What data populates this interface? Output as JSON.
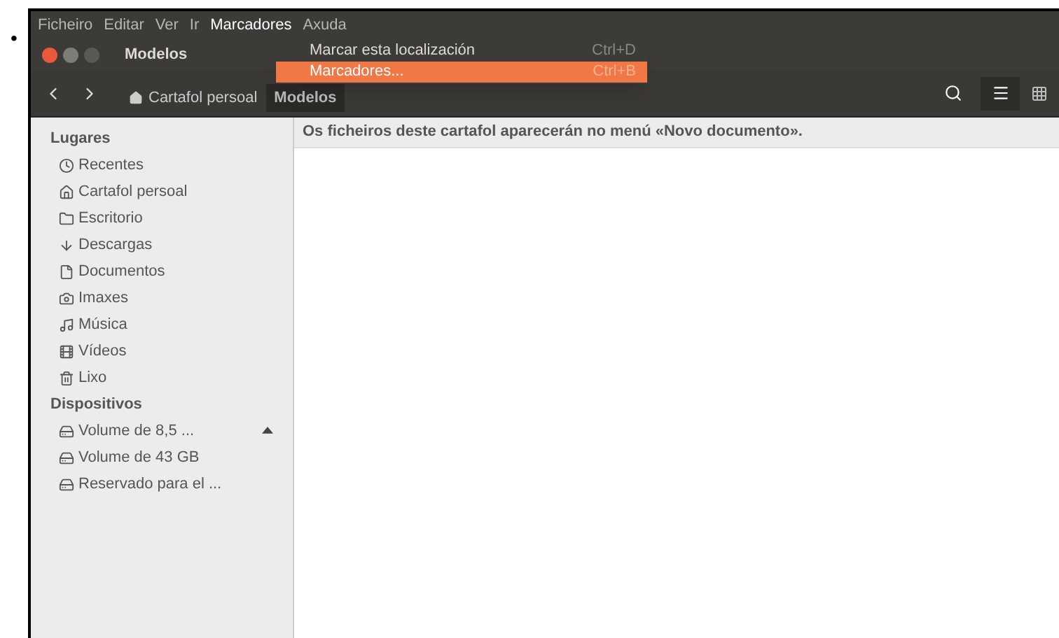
{
  "bullet": "•",
  "menu_bar": [
    {
      "label": "Ficheiro",
      "selected": false
    },
    {
      "label": "Editar",
      "selected": false
    },
    {
      "label": "Ver",
      "selected": false
    },
    {
      "label": "Ir",
      "selected": false
    },
    {
      "label": "Marcadores",
      "selected": true
    },
    {
      "label": "Axuda",
      "selected": false
    }
  ],
  "dropdown": [
    {
      "label": "Marcar esta localización",
      "shortcut": "Ctrl+D",
      "selected": false
    },
    {
      "label": "Marcadores...",
      "shortcut": "Ctrl+B",
      "selected": true
    }
  ],
  "window": {
    "title": "Modelos"
  },
  "breadcrumb": [
    {
      "label": "Cartafol persoal",
      "kind": "home",
      "selected": false
    },
    {
      "label": "Modelos",
      "kind": "folder",
      "selected": true
    }
  ],
  "sidebar": [
    {
      "heading": "Lugares",
      "items": [
        {
          "label": "Recentes",
          "kind": "clock"
        },
        {
          "label": "Cartafol persoal",
          "kind": "home"
        },
        {
          "label": "Escritorio",
          "kind": "desktop"
        },
        {
          "label": "Descargas",
          "kind": "download"
        },
        {
          "label": "Documentos",
          "kind": "document"
        },
        {
          "label": "Imaxes",
          "kind": "camera"
        },
        {
          "label": "Música",
          "kind": "music"
        },
        {
          "label": "Vídeos",
          "kind": "video"
        },
        {
          "label": "Lixo",
          "kind": "trash"
        }
      ]
    },
    {
      "heading": "Dispositivos",
      "items": [
        {
          "label": "Volume de 8,5 ...",
          "kind": "drive",
          "eject": true
        },
        {
          "label": "Volume de 43 GB",
          "kind": "drive",
          "eject": false
        },
        {
          "label": "Reservado para el ...",
          "kind": "drive",
          "eject": false
        }
      ]
    }
  ],
  "content": {
    "message": "Os ficheiros deste cartafol aparecerán no menú «Novo documento»."
  }
}
